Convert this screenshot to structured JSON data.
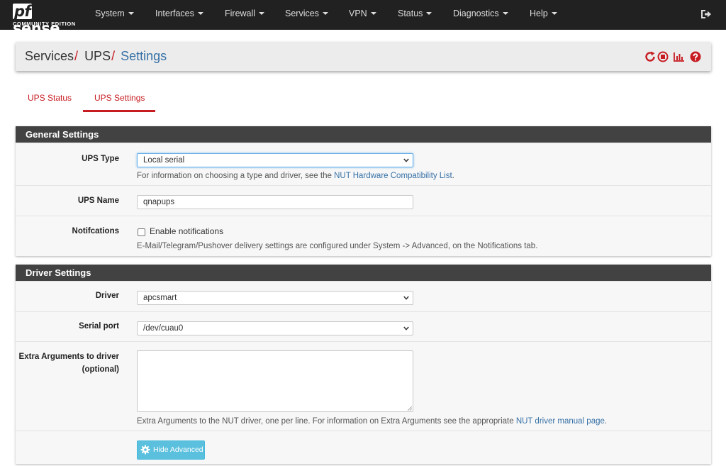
{
  "brand": {
    "logo_prefix": "pf",
    "logo_suffix": "sense",
    "edition": "COMMUNITY EDITION"
  },
  "nav": {
    "items": [
      {
        "label": "System"
      },
      {
        "label": "Interfaces"
      },
      {
        "label": "Firewall"
      },
      {
        "label": "Services"
      },
      {
        "label": "VPN"
      },
      {
        "label": "Status"
      },
      {
        "label": "Diagnostics"
      },
      {
        "label": "Help"
      }
    ],
    "logout_icon": "sign-out-icon"
  },
  "breadcrumb": {
    "items": [
      "Services",
      "UPS"
    ],
    "separator": "/",
    "active": "Settings",
    "icons": [
      "restart-service-icon",
      "stop-service-icon",
      "status-chart-icon",
      "help-icon"
    ]
  },
  "tabs": [
    {
      "label": "UPS Status",
      "active": false
    },
    {
      "label": "UPS Settings",
      "active": true
    }
  ],
  "general": {
    "title": "General Settings",
    "ups_type": {
      "label": "UPS Type",
      "value": "Local serial",
      "help_prefix": "For information on choosing a type and driver, see the ",
      "help_link": "NUT Hardware Compatibility List",
      "help_suffix": "."
    },
    "ups_name": {
      "label": "UPS Name",
      "value": "qnapups"
    },
    "notifications": {
      "label": "Notifcations",
      "checkbox_label": "Enable notifications",
      "checked": false,
      "help": "E-Mail/Telegram/Pushover delivery settings are configured under System -> Advanced, on the Notifications tab."
    }
  },
  "driver": {
    "title": "Driver Settings",
    "driver": {
      "label": "Driver",
      "value": "apcsmart"
    },
    "serial_port": {
      "label": "Serial port",
      "value": "/dev/cuau0"
    },
    "extra_args": {
      "label": "Extra Arguments to driver (optional)",
      "value": "",
      "help_prefix": "Extra Arguments to the NUT driver, one per line. For information on Extra Arguments see the appropriate ",
      "help_link": "NUT driver manual page",
      "help_suffix": "."
    },
    "advanced_button": "Hide Advanced"
  },
  "colors": {
    "navbar": "#212121",
    "accent_red": "#c71c22",
    "link_blue": "#3771a6",
    "panel_header": "#424242",
    "info_button": "#5bc0de"
  }
}
